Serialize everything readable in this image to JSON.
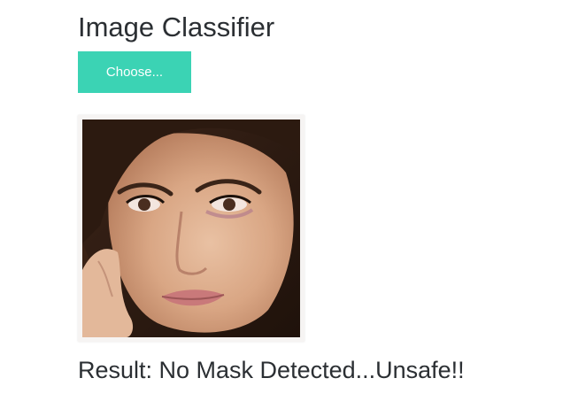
{
  "header": {
    "title": "Image Classifier"
  },
  "upload": {
    "button_label": "Choose..."
  },
  "preview": {
    "icon": "face-photo"
  },
  "result": {
    "text": "Result: No Mask Detected...Unsafe!!"
  },
  "colors": {
    "accent": "#3bd3b4",
    "text": "#2b2f33",
    "background": "#ffffff"
  }
}
